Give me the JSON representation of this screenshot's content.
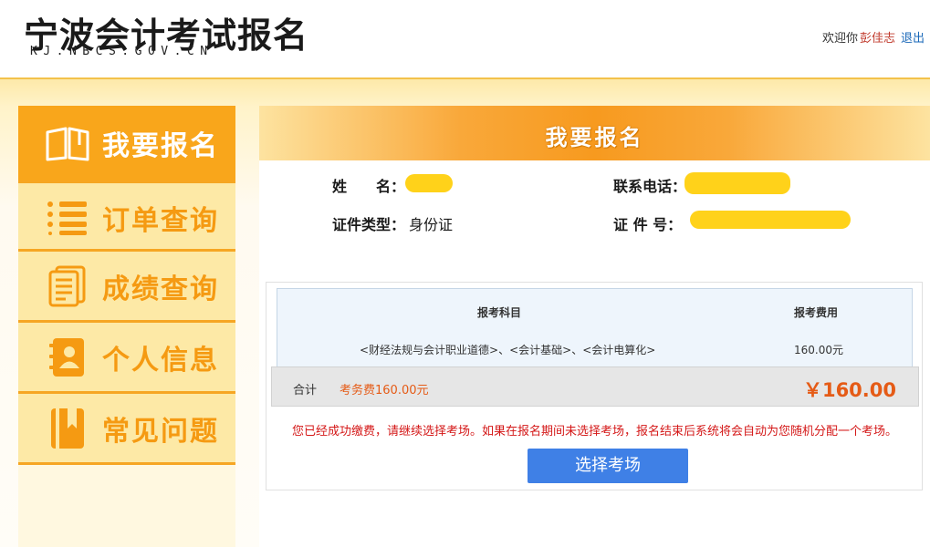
{
  "header": {
    "title": "宁波会计考试报名",
    "subtitle": "KJ.NBCS.GOV.CN",
    "welcome": "欢迎你",
    "username": "彭佳志",
    "logout": "退出"
  },
  "sidebar": {
    "items": [
      {
        "label": "我要报名",
        "icon": "book-icon",
        "active": true
      },
      {
        "label": "订单查询",
        "icon": "list-icon",
        "active": false
      },
      {
        "label": "成绩查询",
        "icon": "document-icon",
        "active": false
      },
      {
        "label": "个人信息",
        "icon": "contact-book-icon",
        "active": false
      },
      {
        "label": "常见问题",
        "icon": "bookmark-book-icon",
        "active": false
      }
    ]
  },
  "main": {
    "title": "我要报名",
    "info": {
      "name_label": "姓　　名：",
      "phone_label": "联系电话：",
      "id_type_label": "证件类型：",
      "id_type_value": "身份证",
      "id_no_label": "证 件 号："
    },
    "table": {
      "headers": [
        "报考科目",
        "报考费用"
      ],
      "rows": [
        {
          "subject": "<财经法规与会计职业道德>、<会计基础>、<会计电算化>",
          "fee": "160.00元"
        }
      ]
    },
    "total": {
      "label": "合计",
      "fee_text": "考务费160.00元",
      "amount": "￥160.00"
    },
    "notice": "您已经成功缴费，请继续选择考场。如果在报名期间未选择考场，报名结束后系统将会自动为您随机分配一个考场。",
    "button": "选择考场"
  },
  "colors": {
    "accent_orange": "#f9a61b",
    "sidebar_bg": "#fde9a6",
    "amount_red": "#e55b16",
    "notice_red": "#d41717",
    "button_blue": "#3f80e6",
    "redaction_yellow": "#ffd21a"
  }
}
